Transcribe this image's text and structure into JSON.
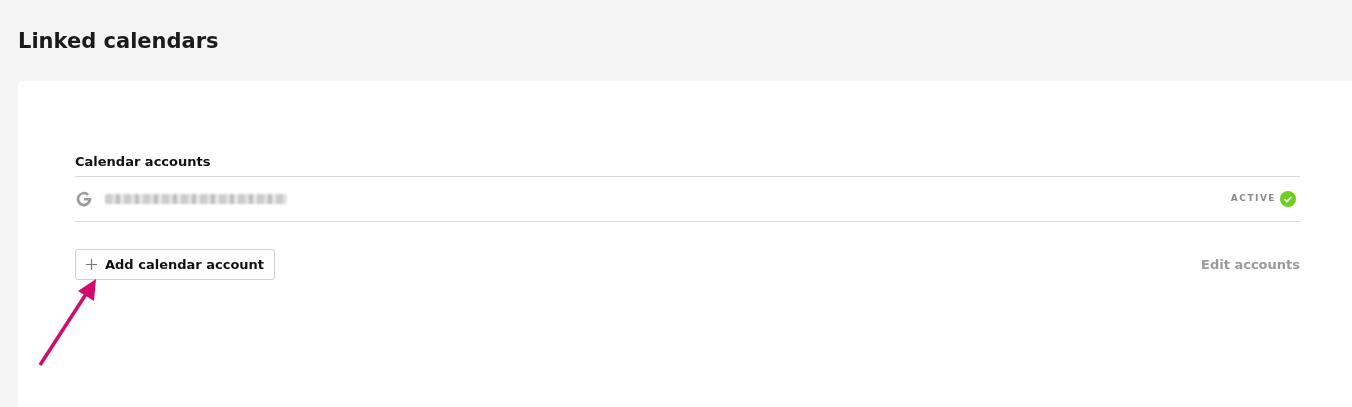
{
  "page": {
    "title": "Linked calendars"
  },
  "section": {
    "heading": "Calendar accounts"
  },
  "accounts": [
    {
      "kind": "google",
      "email_blurred": true,
      "status": "ACTIVE",
      "active": true
    }
  ],
  "actions": {
    "add_button": "Add calendar account",
    "edit_link": "Edit accounts"
  },
  "annotation": {
    "kind": "arrow",
    "color": "#d10a6b"
  }
}
